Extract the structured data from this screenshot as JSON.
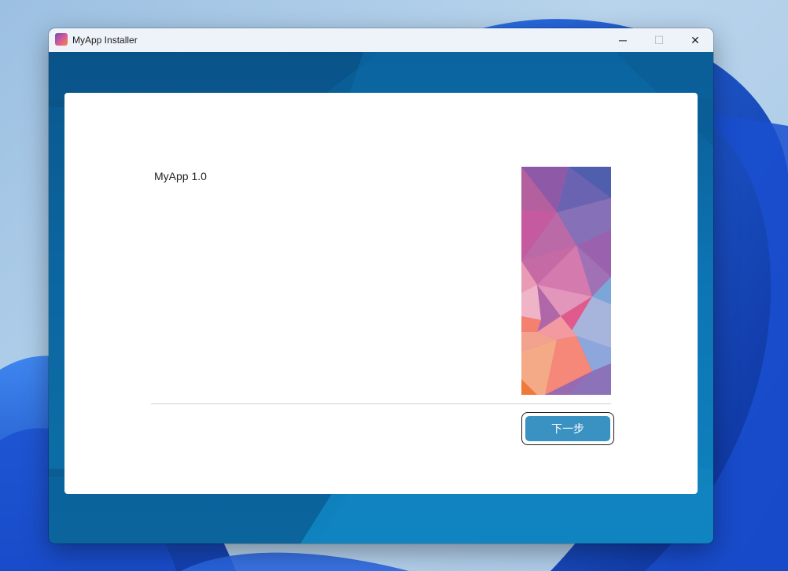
{
  "window": {
    "title": "MyApp Installer",
    "icon": "app-icon",
    "controls": {
      "minimize": "─",
      "maximize": "☐",
      "close": "✕"
    }
  },
  "installer": {
    "product_name": "MyApp 1.0",
    "next_button_label": "下一步"
  },
  "colors": {
    "accent_button": "#3a92c2",
    "window_background": "#0a5a92"
  }
}
